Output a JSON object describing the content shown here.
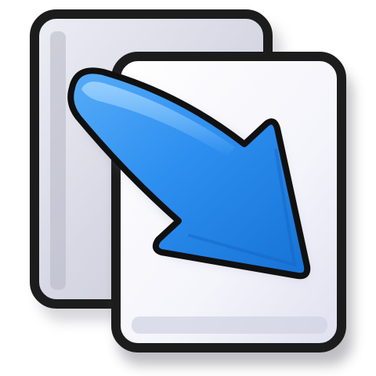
{
  "icon": {
    "name": "copy-to-document-icon",
    "colors": {
      "outline": "#1c1c1c",
      "page_back": "#d6d6e2",
      "page_front": "#f7f7fc",
      "arrow": "#2c8eea",
      "arrow_highlight": "#7cc2ff",
      "shadow": "#8c8c96"
    }
  }
}
